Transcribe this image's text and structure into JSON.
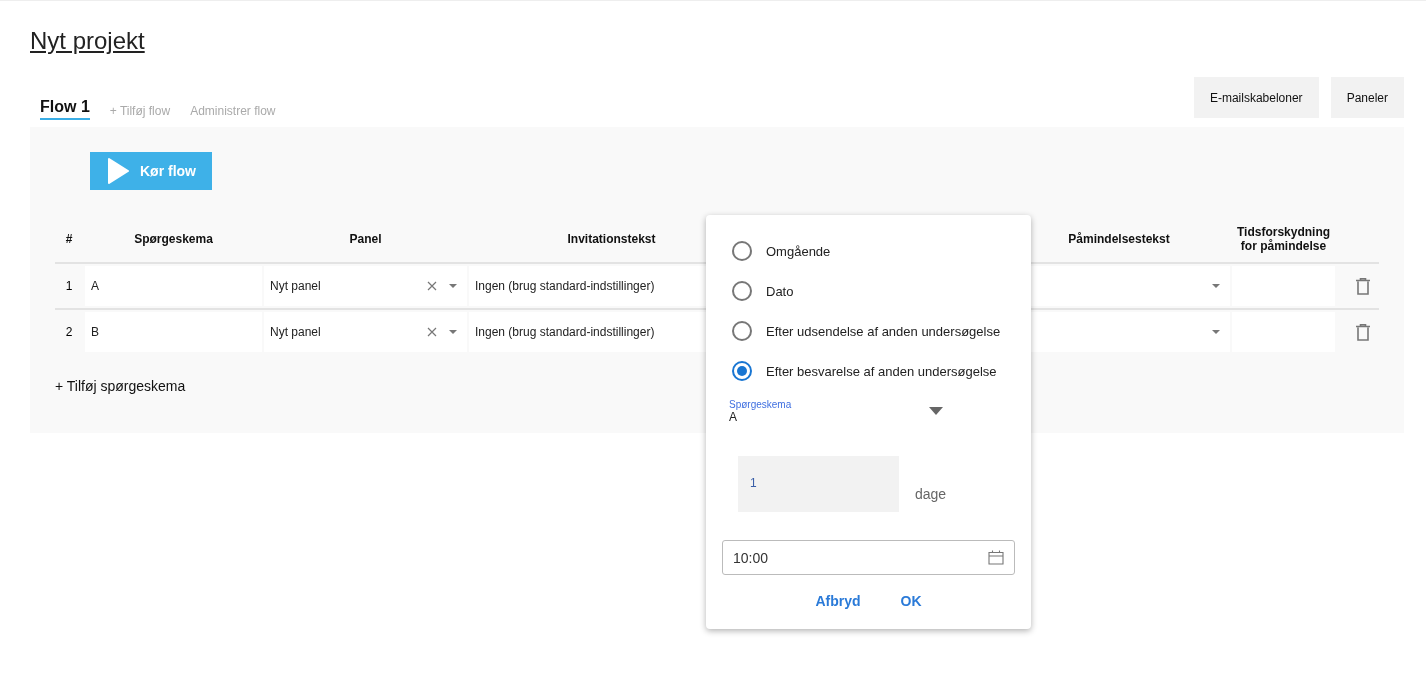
{
  "page_title": "Nyt projekt",
  "tabs": [
    {
      "label": "Flow 1",
      "selected": true
    },
    {
      "label": "+ Tilføj flow",
      "selected": false
    },
    {
      "label": "Administrer flow",
      "selected": false
    }
  ],
  "header_buttons": [
    "E-mailskabeloner",
    "Paneler"
  ],
  "run_button": "Kør flow",
  "table": {
    "columns": [
      "#",
      "Spørgeskema",
      "Panel",
      "Invitationstekst",
      "Påmindelsestekst",
      "Tidsforskydning for påmindelse"
    ],
    "rows": [
      {
        "number": "1",
        "questionnaire": "A",
        "panel": "Nyt panel",
        "invitation_text": "Ingen (brug standard-indstillinger)"
      },
      {
        "number": "2",
        "questionnaire": "B",
        "panel": "Nyt panel",
        "invitation_text": "Ingen (brug standard-indstillinger)"
      }
    ]
  },
  "add_questionnaire": "+ Tilføj spørgeskema",
  "popup": {
    "options": [
      {
        "label": "Omgående",
        "selected": false
      },
      {
        "label": "Dato",
        "selected": false
      },
      {
        "label": "Efter udsendelse af anden undersøgelse",
        "selected": false
      },
      {
        "label": "Efter besvarelse af anden undersøgelse",
        "selected": true
      }
    ],
    "questionnaire_field": {
      "label": "Spørgeskema",
      "value": "A"
    },
    "days_field": {
      "value": "1",
      "unit": "dage"
    },
    "time_field": {
      "value": "10:00"
    },
    "buttons": [
      "Afbryd",
      "OK"
    ]
  }
}
